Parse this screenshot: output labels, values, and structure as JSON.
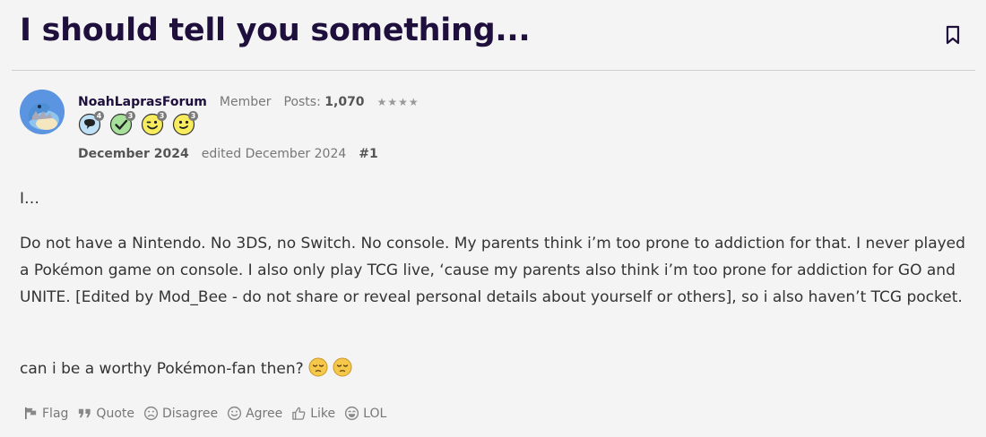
{
  "discussion": {
    "title": "I should tell you something..."
  },
  "post": {
    "author": "NoahLaprasForum",
    "role": "Member",
    "posts_label": "Posts:",
    "posts_count": "1,070",
    "stars": "★★★★",
    "badges": [
      {
        "icon": "speech-bubble-icon",
        "count": "4"
      },
      {
        "icon": "checkmark-icon",
        "count": "3"
      },
      {
        "icon": "wink-face-icon",
        "count": "3"
      },
      {
        "icon": "smile-face-icon",
        "count": "3"
      }
    ],
    "date": "December 2024",
    "edited": "edited December 2024",
    "number": "#1",
    "body": {
      "line1": "I…",
      "paragraph": "Do not have a Nintendo. No 3DS, no Switch. No console. My parents think i’m too prone to addiction for that. I never played a Pokémon game on console. I also only play TCG live, ‘cause my parents also think i’m too prone for addiction for GO and UNITE. [Edited by Mod_Bee - do not share or reveal personal details about yourself or others], so i also haven’t TCG pocket.",
      "question": "can i be a worthy Pokémon-fan then?"
    }
  },
  "actions": {
    "flag": "Flag",
    "quote": "Quote",
    "disagree": "Disagree",
    "agree": "Agree",
    "like": "Like",
    "lol": "LOL"
  },
  "colors": {
    "title": "#1e0f3c",
    "background": "#f4f4f4"
  }
}
